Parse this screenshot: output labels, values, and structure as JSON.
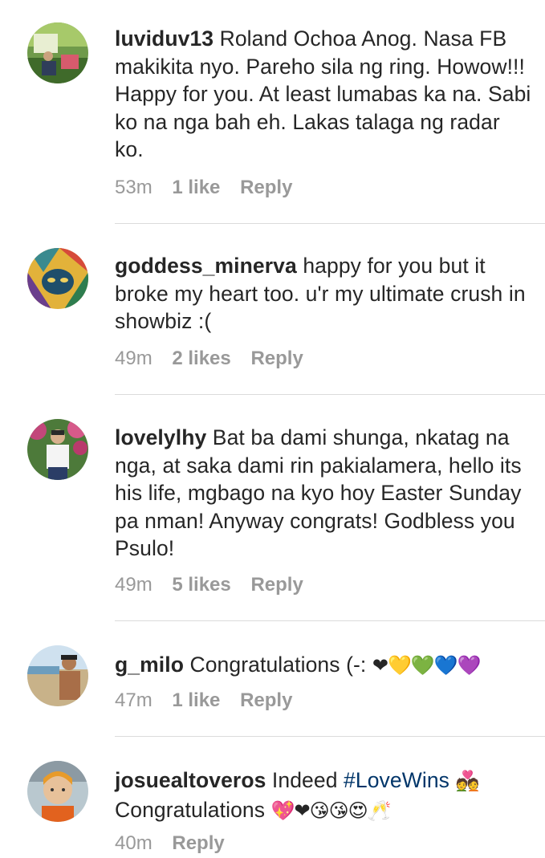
{
  "comments": [
    {
      "username": "luviduv13",
      "text": "Roland Ochoa Anog. Nasa FB makikita nyo. Pareho sila ng ring. Howow!!! Happy for you. At least lumabas ka na. Sabi ko na nga bah eh. Lakas talaga ng radar ko.",
      "time": "53m",
      "likes": "1 like",
      "reply": "Reply"
    },
    {
      "username": "goddess_minerva",
      "text": "happy for you but it broke my heart too. u'r my ultimate crush in showbiz :(",
      "time": "49m",
      "likes": "2 likes",
      "reply": "Reply"
    },
    {
      "username": "lovelylhy",
      "text": "Bat ba dami shunga, nkatag na nga, at saka dami rin pakialamera, hello its his life, mgbago na kyo hoy Easter Sunday pa nman! Anyway congrats! Godbless you Psulo!",
      "time": "49m",
      "likes": "5 likes",
      "reply": "Reply"
    },
    {
      "username": "g_milo",
      "text": "Congratulations (-: ",
      "emoji": "❤💛💚💙💜",
      "time": "47m",
      "likes": "1 like",
      "reply": "Reply"
    },
    {
      "username": "josuealtoveros",
      "text_before": "Indeed ",
      "hashtag": "#LoveWins",
      "emoji_after_hashtag": "💑",
      "text_line2": "Congratulations ",
      "emoji": "💖❤😘😘😍🥂",
      "time": "40m",
      "likes": "",
      "reply": "Reply"
    }
  ],
  "colors": {
    "text": "#262626",
    "meta": "#999999",
    "hashtag": "#003569",
    "divider": "#dbdbdb"
  }
}
